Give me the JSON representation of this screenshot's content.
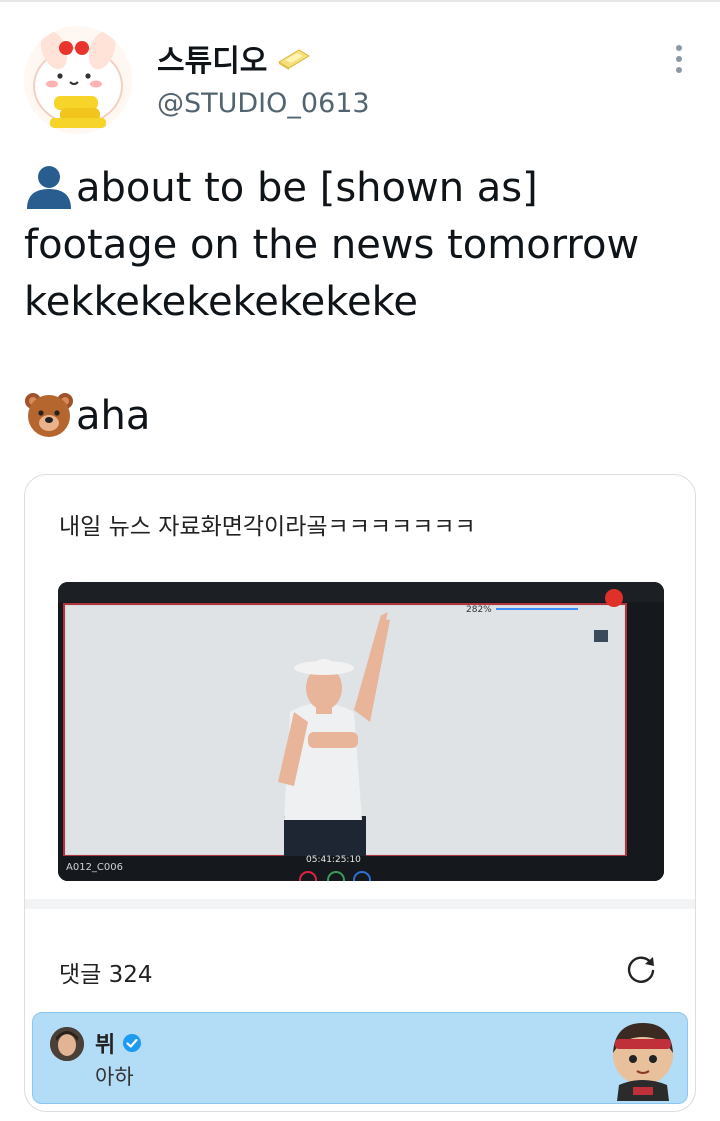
{
  "user": {
    "display_name": "스튜디오",
    "handle": "@STUDIO_0613",
    "name_icon": "butter-icon",
    "avatar_icon": "bunny-avatar-icon"
  },
  "tweet": {
    "line1": "about to be [shown as]",
    "line2": "footage on the news tomorrow",
    "line3": "kekkekekekekekeke",
    "line4": "aha",
    "emoji1": "person-silhouette-icon",
    "emoji2": "bear-face-icon"
  },
  "card": {
    "post_text": "내일 뉴스 자료화면각이라곸ㅋㅋㅋㅋㅋㅋㅋ",
    "video": {
      "zoom": "282%",
      "timecode": "05:41:25:10",
      "clip_label": "A012_C006"
    },
    "comments_label": "댓글 324",
    "comment": {
      "author": "뷔",
      "text": "아하",
      "verified_icon": "verified-badge-icon",
      "sticker_icon": "character-sticker-icon"
    }
  },
  "colors": {
    "accent_blue": "#1d9bf0",
    "comment_bg": "#b3dcf7",
    "muted": "#536471"
  }
}
